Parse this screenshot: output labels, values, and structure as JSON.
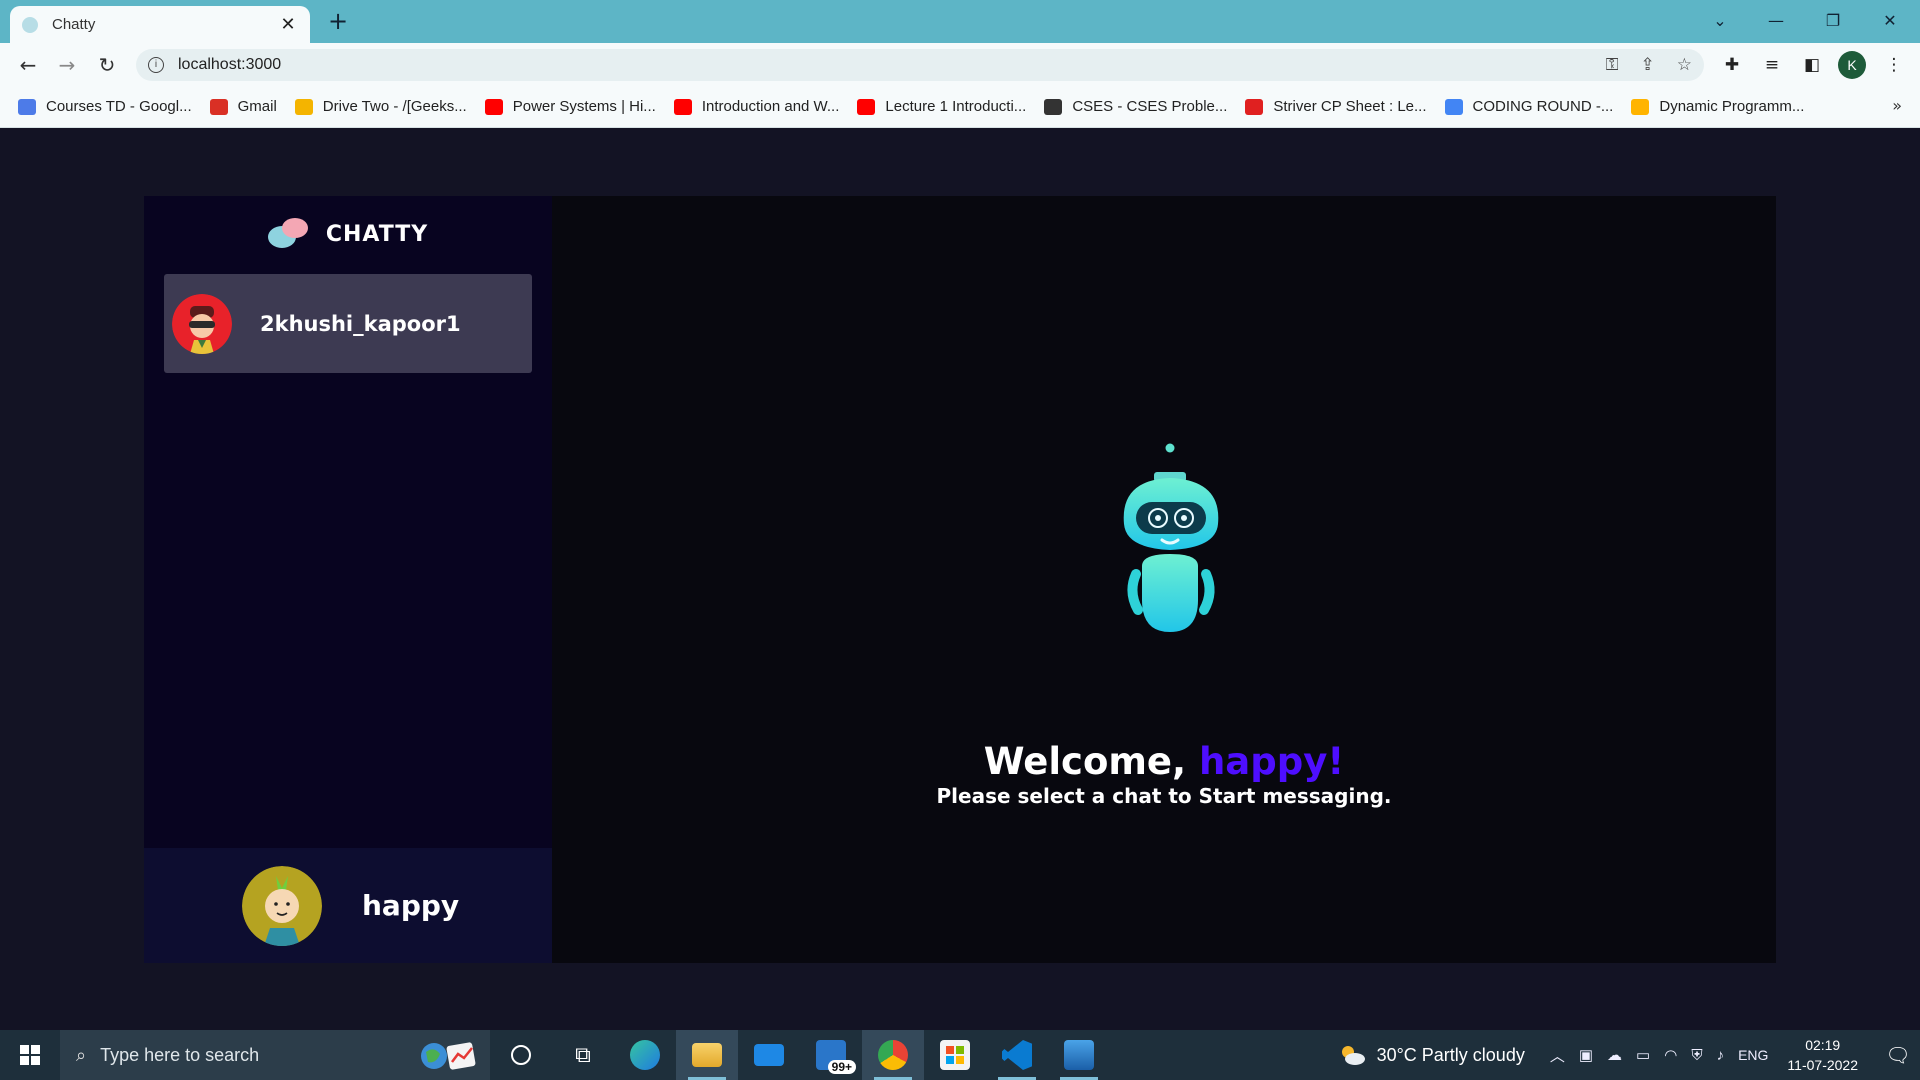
{
  "browser": {
    "tab_title": "Chatty",
    "url": "localhost:3000",
    "profile_initial": "K",
    "bookmarks": [
      {
        "label": "Courses TD - Googl...",
        "color": "#4d7be8"
      },
      {
        "label": "Gmail",
        "color": "#d93025"
      },
      {
        "label": "Drive Two - /[Geeks...",
        "color": "#f4b400"
      },
      {
        "label": "Power Systems | Hi...",
        "color": "#ff0000"
      },
      {
        "label": "Introduction and W...",
        "color": "#ff0000"
      },
      {
        "label": "Lecture 1 Introducti...",
        "color": "#ff0000"
      },
      {
        "label": "CSES - CSES Proble...",
        "color": "#333333"
      },
      {
        "label": "Striver CP Sheet : Le...",
        "color": "#e02020"
      },
      {
        "label": "CODING ROUND -...",
        "color": "#4285f4"
      },
      {
        "label": "Dynamic Programm...",
        "color": "#ffb400"
      }
    ],
    "more_label": "»"
  },
  "app": {
    "brand": "CHATTY",
    "contacts": [
      {
        "username": "2khushi_kapoor1"
      }
    ],
    "current_user": "happy",
    "welcome_prefix": "Welcome, ",
    "welcome_name": "happy!",
    "subtitle": "Please select a chat to Start messaging.",
    "accent": "#4e0eff"
  },
  "taskbar": {
    "search_placeholder": "Type here to search",
    "mail_badge": "99+",
    "weather": "30°C  Partly cloudy",
    "lang": "ENG",
    "time": "02:19",
    "date": "11-07-2022"
  }
}
